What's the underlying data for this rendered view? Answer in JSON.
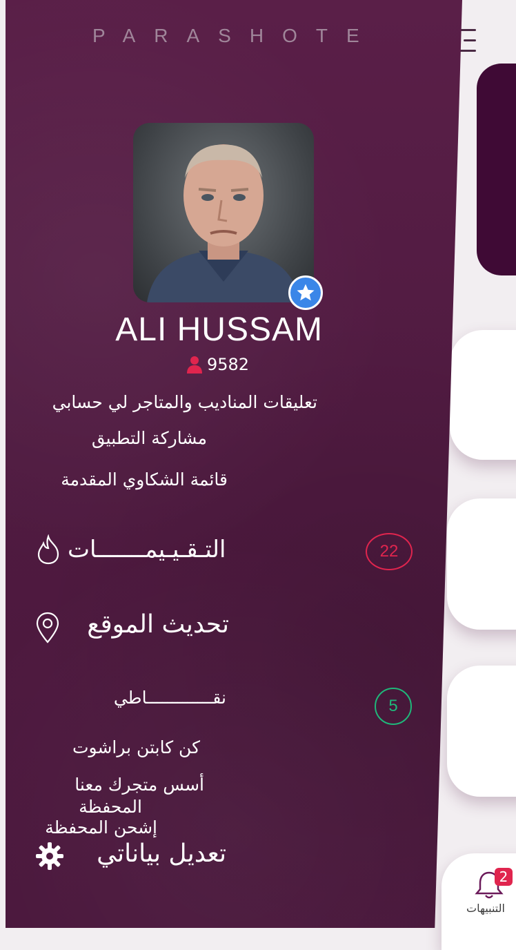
{
  "brand": "PARASHOTE",
  "profile": {
    "name": "ALI HUSSAM",
    "followers": "9582"
  },
  "menu": {
    "comments": "تعليقات المناديب والمتاجر لي حسابي",
    "share_app": "مشاركة التطبيق",
    "complaints": "قائمة الشكاوي المقدمة",
    "ratings": "التـقـيـيمـــــــات",
    "ratings_count": "22",
    "update_location": "تحديث الموقع",
    "points": "نقـــــــــــــاطي",
    "points_count": "5",
    "be_captain": "كن كابتن براشوت",
    "found_store": "أسس متجرك معنا",
    "wallet": "المحفظة",
    "charge_wallet": "إشحن المحفظة",
    "edit_data": "تعديل بياناتي"
  },
  "notifications": {
    "label": "التنبيهات",
    "count": "2"
  },
  "colors": {
    "drawer": "#501b42",
    "ratings_accent": "#e0254e",
    "points_accent": "#1fb87a",
    "star_badge": "#3a86e8"
  }
}
